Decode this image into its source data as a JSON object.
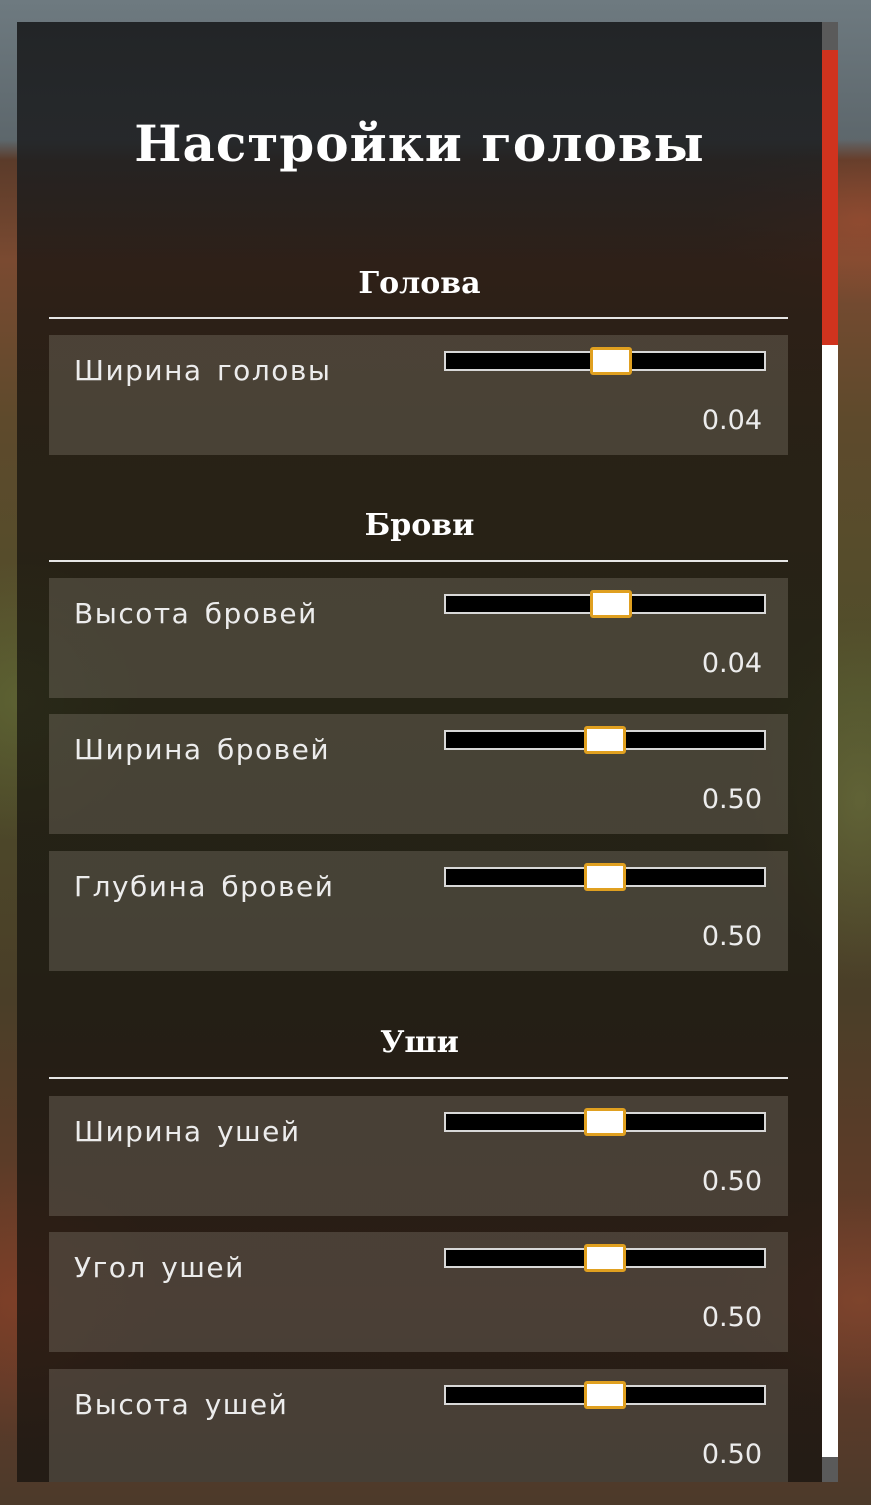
{
  "panel": {
    "title": "Настройки головы"
  },
  "accent_colors": {
    "slider_handle_border": "#e0a020",
    "scrollbar_thumb": "#d0331e"
  },
  "sections": [
    {
      "title": "Голова",
      "items": [
        {
          "label": "Ширина головы",
          "value": "0.04",
          "slider_fraction": 0.52
        }
      ]
    },
    {
      "title": "Брови",
      "items": [
        {
          "label": "Высота бровей",
          "value": "0.04",
          "slider_fraction": 0.52
        },
        {
          "label": "Ширина бровей",
          "value": "0.50",
          "slider_fraction": 0.5
        },
        {
          "label": "Глубина бровей",
          "value": "0.50",
          "slider_fraction": 0.5
        }
      ]
    },
    {
      "title": "Уши",
      "items": [
        {
          "label": "Ширина ушей",
          "value": "0.50",
          "slider_fraction": 0.5
        },
        {
          "label": "Угол ушей",
          "value": "0.50",
          "slider_fraction": 0.5
        },
        {
          "label": "Высота ушей",
          "value": "0.50",
          "slider_fraction": 0.5
        }
      ]
    }
  ]
}
